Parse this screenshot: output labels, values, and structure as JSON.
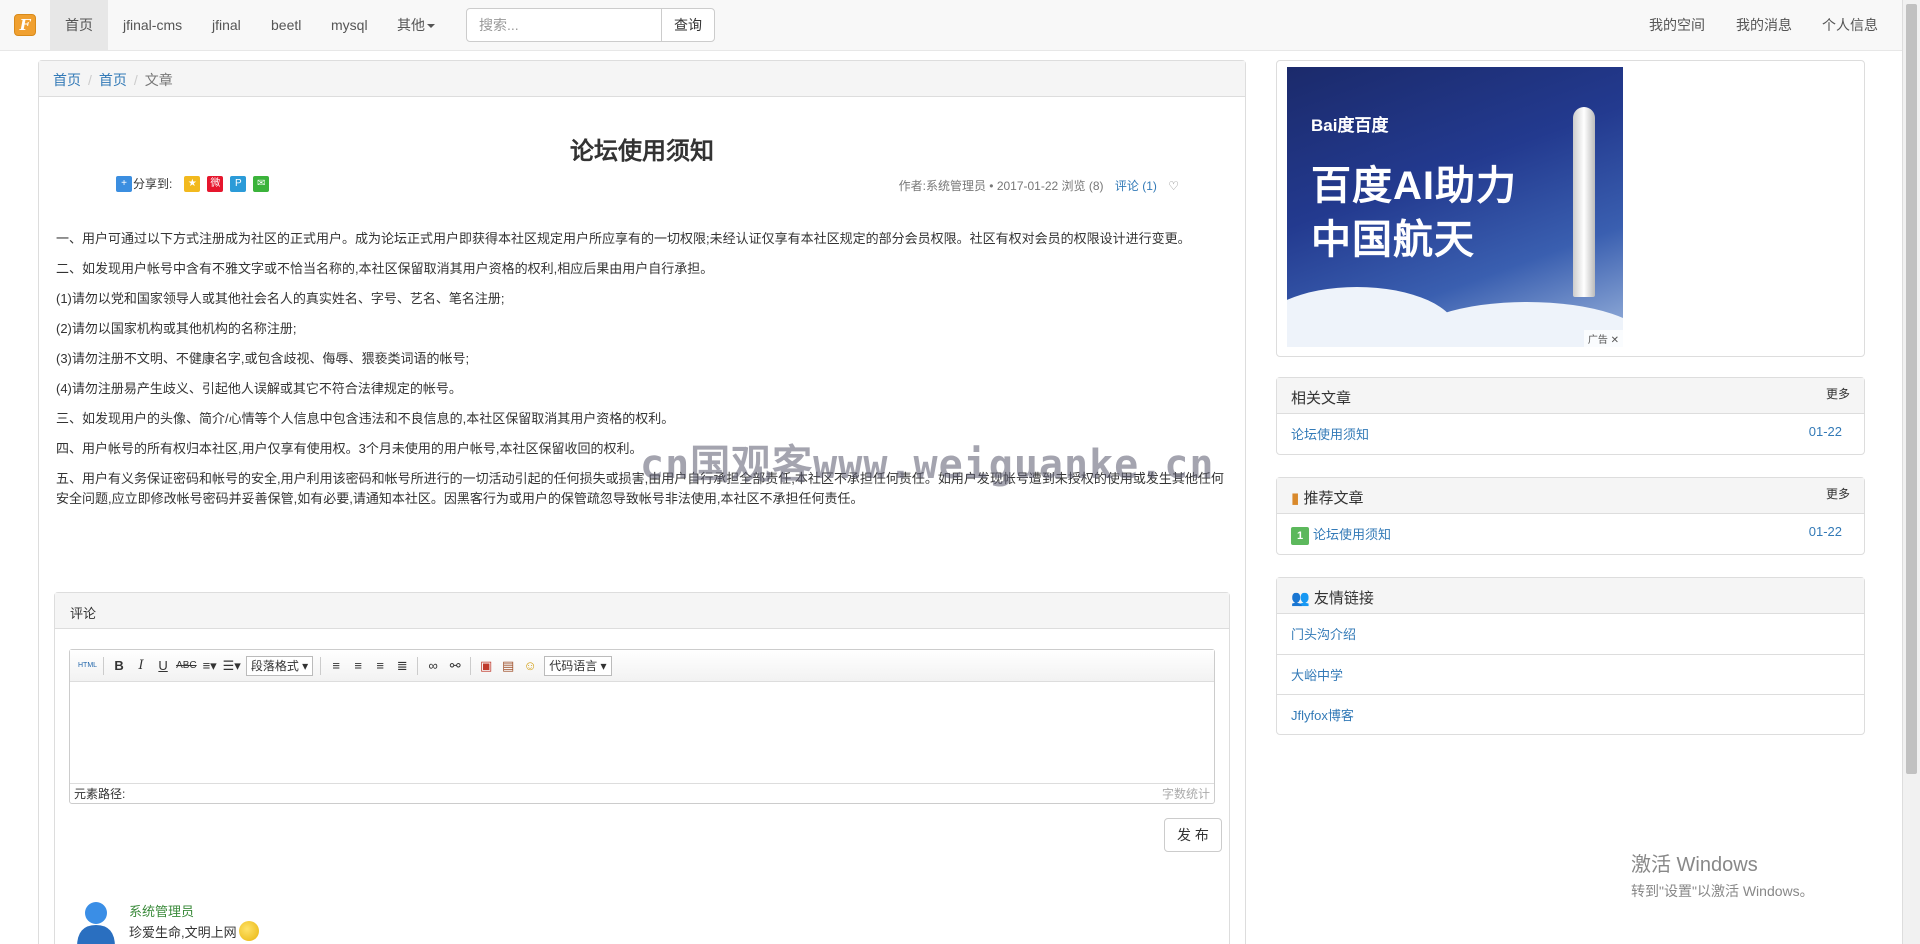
{
  "nav": {
    "logo": "F",
    "items": [
      "首页",
      "jfinal-cms",
      "jfinal",
      "beetl",
      "mysql",
      "其他"
    ],
    "search_placeholder": "搜索...",
    "search_button": "查询",
    "right": [
      "我的空间",
      "我的消息",
      "个人信息"
    ]
  },
  "breadcrumb": [
    "首页",
    "首页",
    "文章"
  ],
  "article": {
    "title": "论坛使用须知",
    "share_label": "分享到:",
    "meta_prefix": "作者:系统管理员 • 2017-01-22 浏览 (8)",
    "meta_comments": "评论 (1)",
    "paragraphs": [
      "一、用户可通过以下方式注册成为社区的正式用户。成为论坛正式用户即获得本社区规定用户所应享有的一切权限;未经认证仅享有本社区规定的部分会员权限。社区有权对会员的权限设计进行变更。",
      "二、如发现用户帐号中含有不雅文字或不恰当名称的,本社区保留取消其用户资格的权利,相应后果由用户自行承担。",
      "(1)请勿以党和国家领导人或其他社会名人的真实姓名、字号、艺名、笔名注册;",
      "(2)请勿以国家机构或其他机构的名称注册;",
      "(3)请勿注册不文明、不健康名字,或包含歧视、侮辱、猥亵类词语的帐号;",
      "(4)请勿注册易产生歧义、引起他人误解或其它不符合法律规定的帐号。",
      "三、如发现用户的头像、简介/心情等个人信息中包含违法和不良信息的,本社区保留取消其用户资格的权利。",
      "四、用户帐号的所有权归本社区,用户仅享有使用权。3个月未使用的用户帐号,本社区保留收回的权利。",
      "五、用户有义务保证密码和帐号的安全,用户利用该密码和帐号所进行的一切活动引起的任何损失或损害,由用户自行承担全部责任,本社区不承担任何责任。如用户发现帐号遭到未授权的使用或发生其他任何安全问题,应立即修改帐号密码并妥善保管,如有必要,请通知本社区。因黑客行为或用户的保管疏忽导致帐号非法使用,本社区不承担任何责任。"
    ]
  },
  "comments": {
    "heading": "评论",
    "editor": {
      "html_btn": "HTML",
      "bold": "B",
      "italic": "I",
      "underline": "U",
      "strike": "ABC",
      "format_select": "段落格式",
      "code_select": "代码语言",
      "path_label": "元素路径:",
      "word_count": "字数统计"
    },
    "publish_button": "发 布",
    "items": [
      {
        "user": "系统管理员",
        "text": "珍爱生命,文明上网"
      }
    ]
  },
  "ad": {
    "logo": "Bai度百度",
    "line1": "百度AI助力",
    "line2": "中国航天",
    "tag": "广告"
  },
  "related": {
    "title": "相关文章",
    "more": "更多",
    "items": [
      {
        "title": "论坛使用须知",
        "date": "01-22"
      }
    ]
  },
  "recommend": {
    "title": "推荐文章",
    "more": "更多",
    "items": [
      {
        "rank": "1",
        "title": "论坛使用须知",
        "date": "01-22"
      }
    ]
  },
  "links": {
    "title": "友情链接",
    "items": [
      "门头沟介绍",
      "大峪中学",
      "Jflyfox博客"
    ]
  },
  "watermark": "cn国观客www.weiguanke.cn",
  "windows": {
    "line1": "激活 Windows",
    "line2": "转到\"设置\"以激活 Windows。"
  },
  "colors": {
    "link": "#337ab7",
    "badge": "#5cb85c",
    "navbar": "#f8f8f8"
  }
}
